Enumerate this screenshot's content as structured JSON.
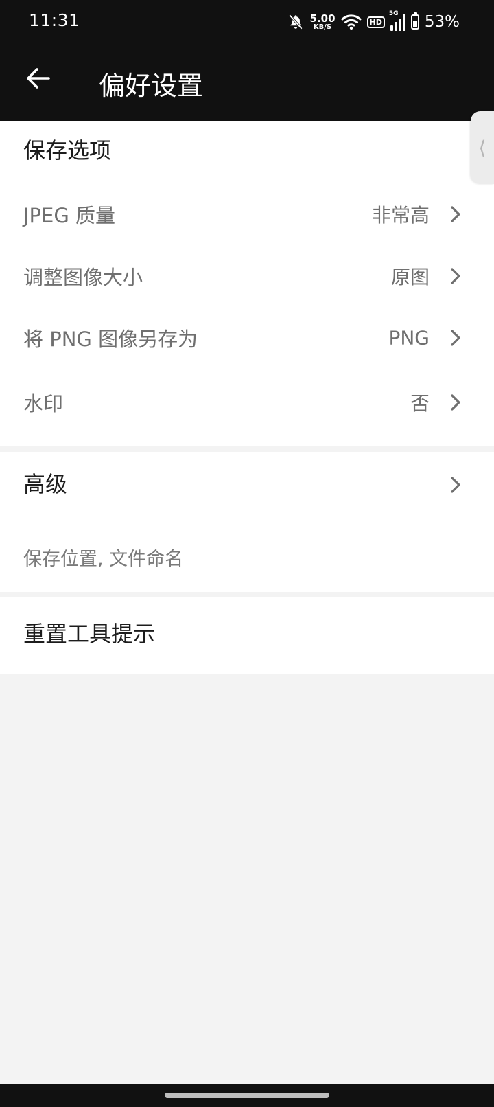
{
  "status": {
    "time": "11:31",
    "net_speed_value": "5.00",
    "net_speed_unit": "KB/S",
    "hd_label": "HD",
    "network_label": "5G",
    "battery_pct": "53%",
    "battery_level": 0.53,
    "icons": [
      "bell-off-icon",
      "wifi-icon",
      "signal-icon",
      "battery-icon"
    ]
  },
  "header": {
    "back_icon": "arrow-left-icon",
    "title": "偏好设置"
  },
  "save_options": {
    "title": "保存选项",
    "items": [
      {
        "label": "JPEG 质量",
        "value": "非常高"
      },
      {
        "label": "调整图像大小",
        "value": "原图"
      },
      {
        "label": "将 PNG 图像另存为",
        "value": "PNG"
      },
      {
        "label": "水印",
        "value": "否"
      }
    ]
  },
  "advanced": {
    "title": "高级",
    "subtitle": "保存位置, 文件命名"
  },
  "reset": {
    "label": "重置工具提示"
  },
  "colors": {
    "bar_background": "#111111",
    "page_background": "#f3f3f3",
    "card_background": "#ffffff",
    "secondary_text": "#6f6f6f"
  }
}
